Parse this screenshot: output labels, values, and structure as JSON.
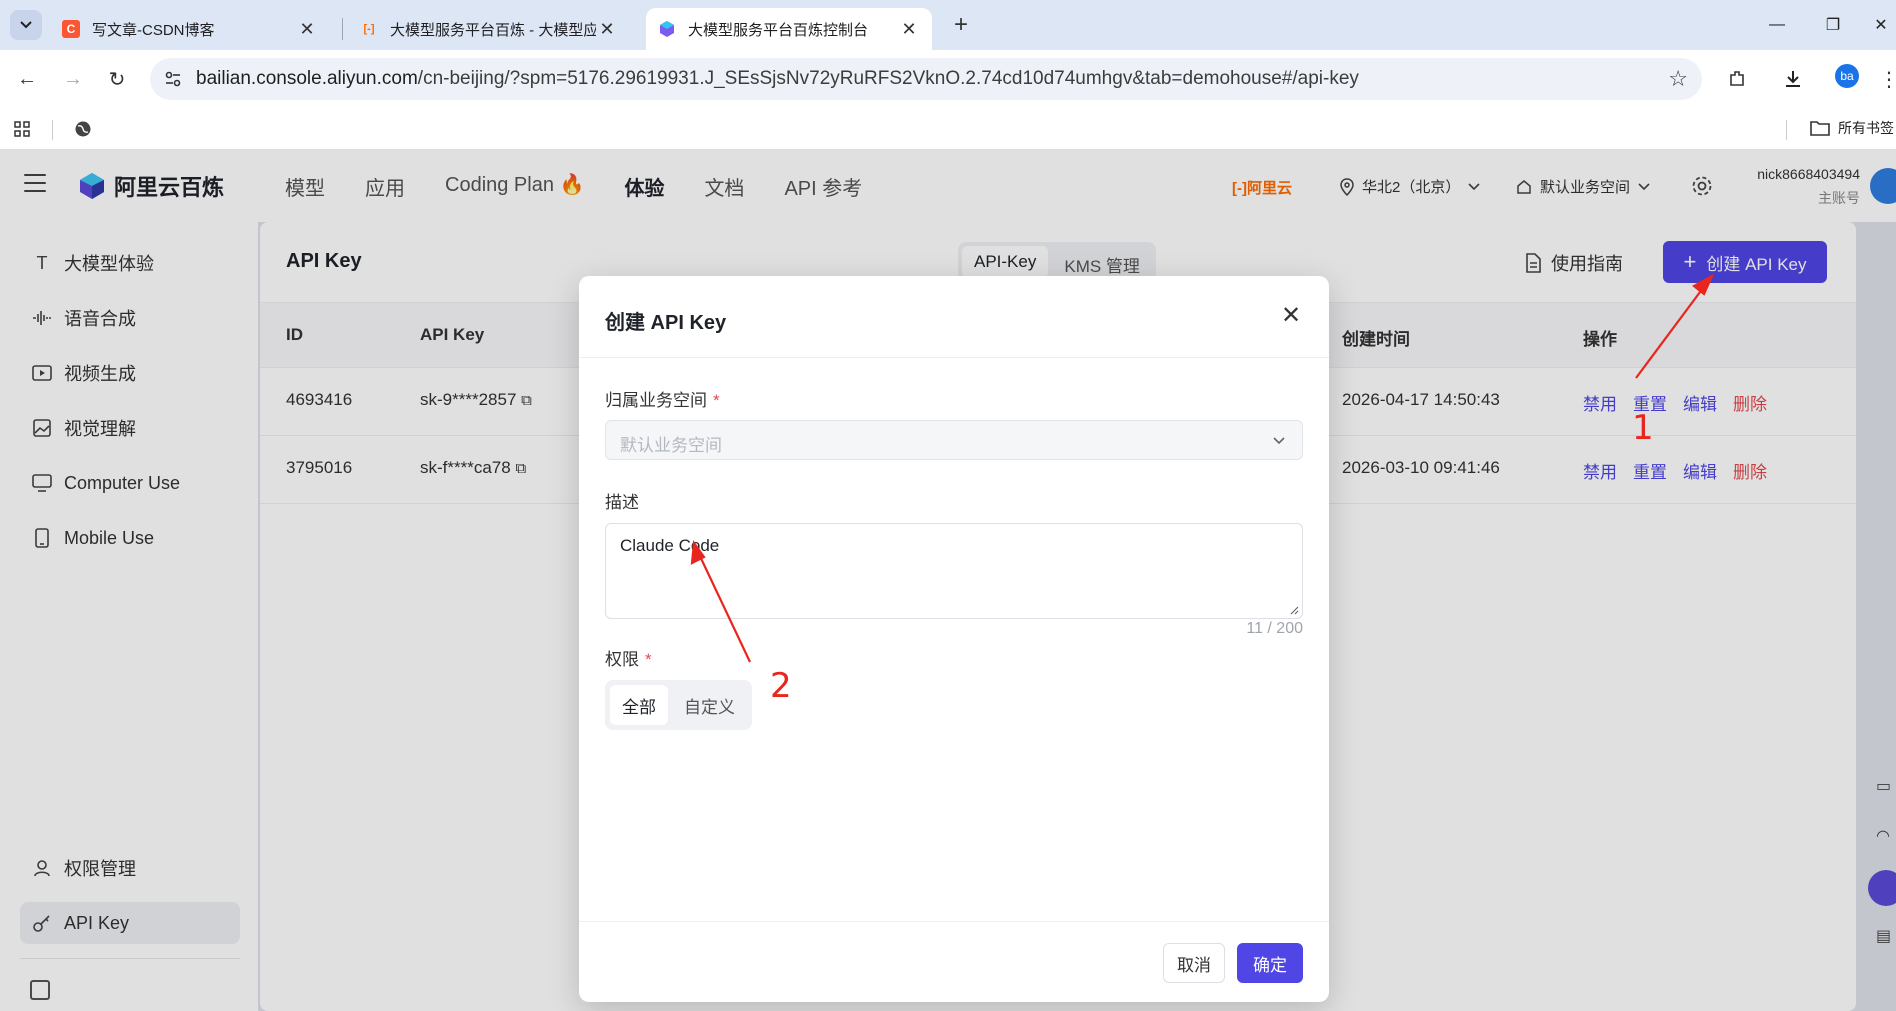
{
  "browser": {
    "tabs": [
      {
        "title": "写文章-CSDN博客",
        "favicon_letter": "C",
        "favicon_color": "#fc5531"
      },
      {
        "title": "大模型服务平台百炼 - 大模型应",
        "favicon_letter": "[-]",
        "favicon_color": "#ff6a00"
      },
      {
        "title": "大模型服务平台百炼控制台",
        "favicon_letter": "",
        "favicon_color": "#7b5cf0"
      }
    ],
    "url_host": "bailian.console.aliyun.com",
    "url_path": "/cn-beijing/?spm=5176.29619931.J_SEsSjsNv72yRuRFS2VknO.2.74cd10d74umhgv&tab=demohouse#/api-key",
    "profile_initials": "ba",
    "bookmarks_all": "所有书签"
  },
  "app": {
    "brand": "阿里云百炼",
    "nav": [
      "模型",
      "应用",
      "Coding Plan",
      "体验",
      "文档",
      "API 参考"
    ],
    "nav_active": "体验",
    "aliyun_logo_text": "[-]阿里云",
    "region": "华北2（北京）",
    "workspace": "默认业务空间",
    "user_name": "nick8668403494",
    "user_role": "主账号",
    "accent_color": "#4f46e5",
    "danger_color": "#e5484d"
  },
  "sidebar": {
    "items": [
      {
        "label": "大模型体验",
        "icon": "text-icon"
      },
      {
        "label": "语音合成",
        "icon": "waveform-icon"
      },
      {
        "label": "视频生成",
        "icon": "video-icon"
      },
      {
        "label": "视觉理解",
        "icon": "image-icon"
      },
      {
        "label": "Computer Use",
        "icon": "monitor-icon"
      },
      {
        "label": "Mobile Use",
        "icon": "phone-icon"
      }
    ],
    "bottom_items": [
      {
        "label": "权限管理",
        "icon": "user-icon"
      },
      {
        "label": "API Key",
        "icon": "key-icon"
      }
    ]
  },
  "page": {
    "title": "API Key",
    "segments": [
      "API-Key",
      "KMS 管理"
    ],
    "guide_label": "使用指南",
    "create_button": "创建 API Key",
    "columns": {
      "id": "ID",
      "key": "API Key",
      "created": "创建时间",
      "actions": "操作"
    },
    "rows": [
      {
        "id": "4693416",
        "key": "sk-9****2857",
        "created": "2026-04-17 14:50:43"
      },
      {
        "id": "3795016",
        "key": "sk-f****ca78",
        "created": "2026-03-10 09:41:46"
      }
    ],
    "row_actions": {
      "disable": "禁用",
      "reset": "重置",
      "edit": "编辑",
      "delete": "删除"
    }
  },
  "modal": {
    "title": "创建 API Key",
    "workspace_label": "归属业务空间",
    "workspace_value": "默认业务空间",
    "desc_label": "描述",
    "desc_value": "Claude Code",
    "desc_counter": "11 / 200",
    "perm_label": "权限",
    "perm_options": [
      "全部",
      "自定义"
    ],
    "required_mark": "*",
    "cancel": "取消",
    "ok": "确定"
  },
  "annotations": {
    "one": "1",
    "two": "2",
    "color": "#e8261e"
  }
}
